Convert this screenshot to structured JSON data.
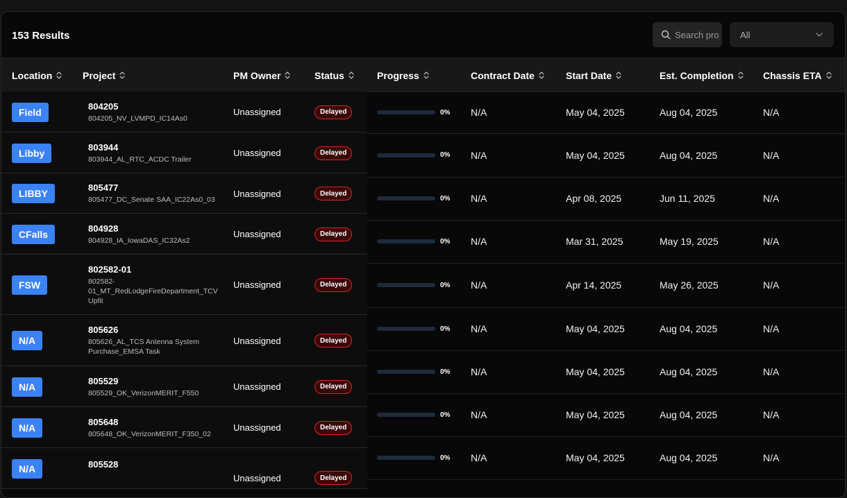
{
  "results_label": "153 Results",
  "search": {
    "placeholder": "Search projects"
  },
  "filter": {
    "selected": "All"
  },
  "columns": {
    "location": "Location",
    "project": "Project",
    "pm_owner": "PM Owner",
    "status": "Status",
    "progress": "Progress",
    "contract_date": "Contract Date",
    "start_date": "Start Date",
    "est_completion": "Est. Completion",
    "chassis_eta": "Chassis ETA"
  },
  "rows": [
    {
      "location": "Field",
      "project_id": "804205",
      "project_name": "804205_NV_LVMPD_IC14As0",
      "pm_owner": "Unassigned",
      "status": "Delayed",
      "progress": "0%",
      "contract_date": "N/A",
      "start_date": "May 04, 2025",
      "est_completion": "Aug 04, 2025",
      "chassis_eta": "N/A"
    },
    {
      "location": "Libby",
      "project_id": "803944",
      "project_name": "803944_AL_RTC_ACDC Trailer",
      "pm_owner": "Unassigned",
      "status": "Delayed",
      "progress": "0%",
      "contract_date": "N/A",
      "start_date": "May 04, 2025",
      "est_completion": "Aug 04, 2025",
      "chassis_eta": "N/A"
    },
    {
      "location": "LIBBY",
      "project_id": "805477",
      "project_name": "805477_DC_Senate SAA_IC22As0_03",
      "pm_owner": "Unassigned",
      "status": "Delayed",
      "progress": "0%",
      "contract_date": "N/A",
      "start_date": "Apr 08, 2025",
      "est_completion": "Jun 11, 2025",
      "chassis_eta": "N/A"
    },
    {
      "location": "CFalls",
      "project_id": "804928",
      "project_name": "804928_IA_IowaDAS_IC32As2",
      "pm_owner": "Unassigned",
      "status": "Delayed",
      "progress": "0%",
      "contract_date": "N/A",
      "start_date": "Mar 31, 2025",
      "est_completion": "May 19, 2025",
      "chassis_eta": "N/A"
    },
    {
      "location": "FSW",
      "project_id": "802582-01",
      "project_name": "802582-01_MT_RedLodgeFireDepartment_TCV Upfit",
      "pm_owner": "Unassigned",
      "status": "Delayed",
      "progress": "0%",
      "contract_date": "N/A",
      "start_date": "Apr 14, 2025",
      "est_completion": "May 26, 2025",
      "chassis_eta": "N/A"
    },
    {
      "location": "N/A",
      "project_id": "805626",
      "project_name": "805626_AL_TCS Antenna System Purchase_EMSA Task",
      "pm_owner": "Unassigned",
      "status": "Delayed",
      "progress": "0%",
      "contract_date": "N/A",
      "start_date": "May 04, 2025",
      "est_completion": "Aug 04, 2025",
      "chassis_eta": "N/A"
    },
    {
      "location": "N/A",
      "project_id": "805529",
      "project_name": "805529_OK_VerizonMERIT_F550",
      "pm_owner": "Unassigned",
      "status": "Delayed",
      "progress": "0%",
      "contract_date": "N/A",
      "start_date": "May 04, 2025",
      "est_completion": "Aug 04, 2025",
      "chassis_eta": "N/A"
    },
    {
      "location": "N/A",
      "project_id": "805648",
      "project_name": "805648_OK_VerizonMERIT_F350_02",
      "pm_owner": "Unassigned",
      "status": "Delayed",
      "progress": "0%",
      "contract_date": "N/A",
      "start_date": "May 04, 2025",
      "est_completion": "Aug 04, 2025",
      "chassis_eta": "N/A"
    },
    {
      "location": "N/A",
      "project_id": "805528",
      "project_name": "",
      "pm_owner": "Unassigned",
      "status": "Delayed",
      "progress": "0%",
      "contract_date": "N/A",
      "start_date": "May 04, 2025",
      "est_completion": "Aug 04, 2025",
      "chassis_eta": "N/A"
    }
  ]
}
